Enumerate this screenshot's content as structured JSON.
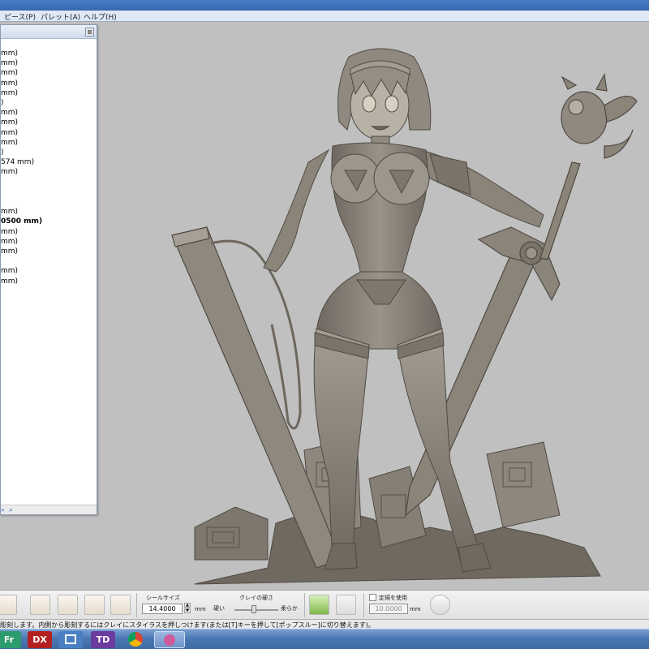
{
  "menu": {
    "items": [
      {
        "label": "ピース(P)"
      },
      {
        "label": "パレット(A)"
      },
      {
        "label": "ヘルプ(H)"
      }
    ]
  },
  "panel": {
    "close_glyph": "⊠",
    "lines": [
      {
        "text": "mm)"
      },
      {
        "text": "mm)"
      },
      {
        "text": "mm)"
      },
      {
        "text": "mm)"
      },
      {
        "text": "mm)"
      },
      {
        "text": ")"
      },
      {
        "text": "mm)"
      },
      {
        "text": "mm)"
      },
      {
        "text": "mm)"
      },
      {
        "text": "mm)"
      },
      {
        "text": ")"
      },
      {
        "text": "574 mm)"
      },
      {
        "text": "mm)"
      },
      {
        "text": ""
      },
      {
        "text": ""
      },
      {
        "text": ""
      },
      {
        "text": "mm)"
      },
      {
        "text": "0500 mm)",
        "bold": true
      },
      {
        "text": "mm)"
      },
      {
        "text": "mm)"
      },
      {
        "text": "mm)"
      },
      {
        "text": ""
      },
      {
        "text": "mm)"
      },
      {
        "text": "mm)"
      }
    ],
    "footer_icons": [
      "search-icon",
      "search-icon"
    ]
  },
  "toolbar": {
    "seal_size_label": "シールサイズ",
    "seal_size_value": "14.4000",
    "seal_size_unit": "mm",
    "clay_hardness_label": "クレイの硬さ",
    "hard_label": "硬い",
    "soft_label": "柔らか",
    "clay_hardness": 0.45,
    "use_fixed_label": "定規を使用",
    "fixed_value": "10.0000",
    "fixed_unit": "mm"
  },
  "status": {
    "text": "彫刻します。内側から彫刻するにはクレイにスタイラスを押しつけます(または[T]キーを押して[ポップスルー]に切り替えます)。"
  },
  "taskbar": {
    "apps": [
      {
        "label": "Fr",
        "icon": "fireworks-icon",
        "color": "#2d9c6c"
      },
      {
        "label": "DX",
        "icon": "dx-icon",
        "color": "#b42020"
      },
      {
        "label": "",
        "icon": "window-app-icon",
        "color": "#4a7fc4"
      },
      {
        "label": "TD",
        "icon": "td-icon",
        "color": "#6b3b9e"
      },
      {
        "label": "",
        "icon": "chrome-icon",
        "color": "#e0e0e0"
      },
      {
        "label": "",
        "icon": "freeform-icon",
        "color": "#d05a9a"
      }
    ]
  },
  "colors": {
    "viewport_bg": "#c0c0c0",
    "clay": "#8c857b",
    "clay_dark": "#5e5850",
    "clay_light": "#b0aaa0"
  }
}
